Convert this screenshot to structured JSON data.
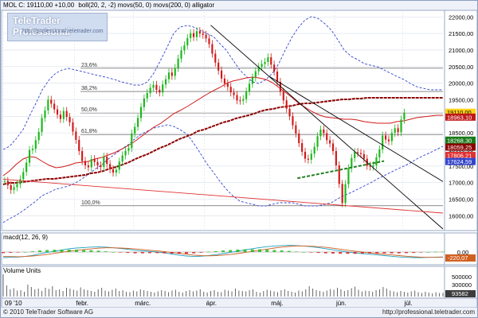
{
  "header": {
    "instrument": "MOL C: 19110,00 +10,00",
    "indicators": "boll(20, 2, -2) movs(50, 0) movs(200, 0) alligator"
  },
  "logo": {
    "title": "TeleTrader Professional",
    "url": "http://professional.teletrader.com"
  },
  "footer": {
    "copyright": "© 2010 TeleTrader Software AG",
    "url": "http://professional.teletrader.com"
  },
  "colors": {
    "bg": "#ffffff",
    "grid": "#d8dde8",
    "up": "#18b818",
    "down": "#d01818",
    "boll": "#3344cc",
    "ma50": "#d01818",
    "ma200": "#8b0000",
    "jaw": "#4060e0",
    "teeth": "#e03030",
    "lips": "#30b030",
    "trend": "#000000",
    "support": "#e03030",
    "support_dash": "#208020"
  },
  "chart_data": [
    {
      "type": "candlestick",
      "title": "MOL C: 19110,00 +10,00",
      "y_axis_side": "right",
      "ylim": [
        15600,
        22150
      ],
      "yticks": [
        16000,
        16500,
        17000,
        17500,
        18000,
        18500,
        19000,
        19500,
        20000,
        20500,
        21000,
        21500,
        22000
      ],
      "ytick_labels": [
        "16000,00",
        "16500,00",
        "17000,00",
        "17500,00",
        "18000,00",
        "18500,00",
        "19000,00",
        "19500,00",
        "20000,00",
        "20500,00",
        "21000,00",
        "21500,00",
        "22000,00"
      ],
      "xlim": [
        0,
        142
      ],
      "xticks": [
        {
          "x": 0,
          "label": "09 '10"
        },
        {
          "x": 23,
          "label": "febr."
        },
        {
          "x": 42,
          "label": "márc."
        },
        {
          "x": 65,
          "label": "ápr."
        },
        {
          "x": 86,
          "label": "máj."
        },
        {
          "x": 107,
          "label": "jún."
        },
        {
          "x": 129,
          "label": "júl."
        }
      ],
      "series": [
        {
          "name": "close",
          "values": [
            17050,
            16920,
            16780,
            16860,
            16950,
            17100,
            17320,
            17600,
            17980,
            18020,
            18280,
            18530,
            18950,
            19180,
            19500,
            19380,
            19210,
            19050,
            18920,
            19160,
            18980,
            18820,
            18540,
            18290,
            17950,
            17650,
            17520,
            17460,
            17710,
            17620,
            17520,
            17470,
            17780,
            17560,
            17400,
            17300,
            17390,
            17630,
            17820,
            17960,
            18040,
            18480,
            18680,
            18950,
            19280,
            19540,
            19700,
            19860,
            19950,
            19800,
            19720,
            19960,
            20120,
            20320,
            20220,
            20460,
            20740,
            20990,
            21140,
            21360,
            21510,
            21390,
            21570,
            21500,
            21460,
            21350,
            21180,
            20890,
            20620,
            20380,
            20140,
            19990,
            19890,
            19720,
            19640,
            19480,
            19470,
            19520,
            19750,
            19980,
            20170,
            20360,
            20490,
            20580,
            20640,
            20780,
            20560,
            20350,
            20040,
            19740,
            19480,
            19230,
            19000,
            18730,
            18480,
            18190,
            17930,
            17720,
            17690,
            17870,
            18080,
            18400,
            18600,
            18490,
            18280,
            18180,
            17950,
            17520,
            16960,
            16380,
            16950,
            17430,
            17740,
            17920,
            17890,
            17860,
            17720,
            17510,
            17480,
            17520,
            17760,
            18000,
            18420,
            18300,
            18250,
            18500,
            18640,
            18520,
            18900,
            19110
          ]
        },
        {
          "name": "open",
          "values": [
            17050,
            17050,
            16920,
            16780,
            16860,
            16950,
            17100,
            17320,
            17600,
            17980,
            18020,
            18280,
            18530,
            18950,
            19180,
            19500,
            19380,
            19210,
            19050,
            18920,
            19160,
            18980,
            18820,
            18540,
            18290,
            17950,
            17650,
            17520,
            17460,
            17710,
            17620,
            17520,
            17470,
            17780,
            17560,
            17400,
            17300,
            17390,
            17630,
            17820,
            17960,
            18040,
            18480,
            18680,
            18950,
            19280,
            19540,
            19700,
            19860,
            19950,
            19800,
            19720,
            19960,
            20120,
            20320,
            20220,
            20460,
            20740,
            20990,
            21140,
            21360,
            21510,
            21390,
            21570,
            21500,
            21460,
            21350,
            21180,
            20890,
            20620,
            20380,
            20140,
            19990,
            19890,
            19720,
            19640,
            19480,
            19470,
            19520,
            19750,
            19980,
            20170,
            20360,
            20490,
            20580,
            20640,
            20780,
            20560,
            20350,
            20040,
            19740,
            19480,
            19230,
            19000,
            18730,
            18480,
            18190,
            17930,
            17720,
            17690,
            17870,
            18080,
            18400,
            18600,
            18490,
            18280,
            18180,
            17950,
            17520,
            16960,
            16380,
            16950,
            17430,
            17740,
            17920,
            17890,
            17860,
            17720,
            17510,
            17480,
            17520,
            17760,
            18000,
            18420,
            18300,
            18250,
            18500,
            18640,
            18520,
            18900
          ]
        },
        {
          "name": "Bollinger upper",
          "values": [
            18000,
            18100,
            18300,
            18600,
            19000,
            19400,
            19800,
            20100,
            20300,
            20400,
            20450,
            20400,
            20350,
            20300,
            20250,
            20200,
            20150,
            20100,
            20050,
            20000,
            19950,
            19950,
            20050,
            20300,
            20700,
            21100,
            21500,
            21700,
            21750,
            21700,
            21600,
            21500,
            21400,
            21200,
            21000,
            20700,
            20400,
            20200,
            20050,
            20000,
            20100,
            20300,
            20600,
            21000,
            21400,
            21700,
            21900,
            22000,
            21950,
            21800,
            21600,
            21300,
            21000,
            20800,
            20700,
            20600,
            20550,
            20500,
            20400,
            20300,
            20200,
            20100,
            20000,
            19900,
            19850,
            19800,
            19800,
            19800
          ]
        },
        {
          "name": "Bollinger lower",
          "values": [
            15800,
            15900,
            16000,
            16150,
            16300,
            16450,
            16600,
            16700,
            16800,
            16850,
            16900,
            17000,
            17100,
            17250,
            17400,
            17550,
            17700,
            17850,
            18000,
            18150,
            18300,
            18450,
            18550,
            18650,
            18700,
            18750,
            18700,
            18600,
            18450,
            18200,
            17900,
            17600,
            17300,
            17050,
            16800,
            16600,
            16450,
            16400,
            16350,
            16300,
            16300,
            16350,
            16400,
            16400,
            16400,
            16350,
            16300,
            16300,
            16300,
            16350,
            16400,
            16500,
            16600,
            16700,
            16800,
            16900,
            17000,
            17100,
            17200,
            17300,
            17400,
            17500,
            17600,
            17700,
            17800,
            17900,
            18000,
            18100
          ]
        },
        {
          "name": "movs(50)",
          "values": [
            17200,
            17350,
            17550,
            17700,
            17780,
            17750,
            17650,
            17520,
            17440,
            17460,
            17520,
            17580,
            17620,
            17650,
            17700,
            17760,
            17820,
            17900,
            18000,
            18120,
            18250,
            18380,
            18520,
            18660,
            18800,
            18940,
            19070,
            19180,
            19290,
            19410,
            19530,
            19650,
            19770,
            19880,
            19980,
            20060,
            20120,
            20160,
            20180,
            20170,
            20120,
            20020,
            19880,
            19720,
            19560,
            19400,
            19260,
            19150,
            19060,
            18990,
            18950,
            18930,
            18920,
            18900,
            18880,
            18850,
            18820,
            18800,
            18790,
            18800,
            18830,
            18870,
            18910,
            18950,
            18980,
            19000,
            19020,
            19030
          ]
        },
        {
          "name": "movs(200)",
          "values": [
            16950,
            16980,
            17000,
            17020,
            17040,
            17060,
            17080,
            17100,
            17120,
            17140,
            17160,
            17180,
            17200,
            17230,
            17270,
            17310,
            17360,
            17420,
            17480,
            17550,
            17620,
            17700,
            17780,
            17860,
            17950,
            18040,
            18130,
            18220,
            18300,
            18380,
            18460,
            18540,
            18610,
            18680,
            18750,
            18810,
            18870,
            18930,
            18990,
            19040,
            19090,
            19140,
            19190,
            19230,
            19270,
            19300,
            19330,
            19360,
            19380,
            19400,
            19420,
            19440,
            19460,
            19480,
            19500,
            19520,
            19530,
            19540,
            19550,
            19550,
            19550,
            19560,
            19560,
            19560,
            19560,
            19560,
            19560,
            19560,
            19560,
            19560,
            19560
          ]
        }
      ],
      "price_labels": [
        "19110,00",
        "18963,10",
        "18268,30",
        "18059,25",
        "17806,21",
        "17624,59"
      ],
      "fibonacci": [
        {
          "label": "23,6%",
          "level": 20450
        },
        {
          "label": "38,2%",
          "level": 19750
        },
        {
          "label": "50,0%",
          "level": 19100
        },
        {
          "label": "61,8%",
          "level": 18450
        },
        {
          "label": "100,0%",
          "level": 16300
        }
      ],
      "trendlines": [
        {
          "name": "falling trendline 1",
          "from": [
            67,
            21750
          ],
          "to": [
            142,
            15600
          ]
        },
        {
          "name": "falling trendline 2",
          "from": [
            86,
            20200
          ],
          "to": [
            142,
            17030
          ]
        },
        {
          "name": "long support",
          "from": [
            0,
            17100
          ],
          "to": [
            142,
            16080
          ]
        },
        {
          "name": "short support",
          "from": [
            95,
            17130
          ],
          "to": [
            123,
            17650
          ]
        }
      ]
    },
    {
      "type": "line",
      "title": "macd(12, 26, 9)",
      "ylim": [
        -500,
        500
      ],
      "yticks": [
        0
      ],
      "ytick_labels": [
        "0,00"
      ],
      "value_label": "-220,07",
      "series": [
        {
          "name": "macd",
          "values": [
            -250,
            -240,
            -230,
            -200,
            -150,
            -80,
            -20,
            40,
            90,
            150,
            180,
            200,
            220,
            230,
            220,
            190,
            160,
            120,
            80,
            50,
            30,
            0,
            -40,
            -90,
            -140,
            -180,
            -200,
            -190,
            -160,
            -120,
            -70,
            -20,
            40,
            100,
            150,
            200,
            240,
            270,
            290,
            300,
            290,
            270,
            240,
            200,
            150,
            100,
            50,
            0,
            -40,
            -70,
            -100,
            -130,
            -160,
            -190,
            -220,
            -240,
            -250,
            -250,
            -240,
            -230,
            -220
          ]
        },
        {
          "name": "signal",
          "values": [
            -200,
            -205,
            -210,
            -200,
            -180,
            -150,
            -110,
            -60,
            -10,
            40,
            80,
            110,
            140,
            170,
            190,
            190,
            180,
            160,
            140,
            110,
            80,
            50,
            20,
            -20,
            -60,
            -100,
            -140,
            -160,
            -170,
            -160,
            -140,
            -110,
            -70,
            -20,
            30,
            80,
            130,
            180,
            220,
            250,
            270,
            270,
            260,
            240,
            210,
            170,
            130,
            80,
            40,
            0,
            -40,
            -70,
            -100,
            -130,
            -160,
            -190,
            -210,
            -230,
            -240,
            -240,
            -235
          ]
        },
        {
          "name": "histogram",
          "values": [
            -50,
            -35,
            -20,
            0,
            30,
            70,
            90,
            100,
            100,
            110,
            100,
            90,
            80,
            60,
            30,
            0,
            -20,
            -40,
            -60,
            -60,
            -50,
            -50,
            -60,
            -70,
            -80,
            -80,
            -60,
            -30,
            10,
            40,
            70,
            90,
            110,
            120,
            120,
            120,
            110,
            90,
            70,
            50,
            20,
            0,
            -20,
            -40,
            -60,
            -70,
            -80,
            -80,
            -80,
            -70,
            -60,
            -60,
            -60,
            -60,
            -60,
            -50,
            -40,
            -20,
            0,
            10,
            15
          ]
        }
      ]
    },
    {
      "type": "bar",
      "title": "Volume Units",
      "ylim": [
        0,
        560000
      ],
      "yticks": [
        300000,
        500000
      ],
      "ytick_labels": [
        "300000",
        "500000"
      ],
      "value_label": "93582",
      "values": [
        620000,
        280000,
        180000,
        210000,
        150000,
        160000,
        120000,
        300000,
        240000,
        180000,
        200000,
        140000,
        220000,
        190000,
        260000,
        160000,
        180000,
        140000,
        220000,
        200000,
        170000,
        150000,
        230000,
        180000,
        160000,
        140000,
        120000,
        180000,
        220000,
        150000,
        130000,
        170000,
        200000,
        140000,
        160000,
        120000,
        110000,
        150000,
        130000,
        180000,
        160000,
        140000,
        120000,
        100000,
        130000,
        160000,
        140000,
        110000,
        150000,
        170000,
        120000,
        100000,
        140000,
        160000,
        130000,
        150000,
        180000,
        120000,
        100000,
        140000,
        160000,
        120000,
        110000,
        170000,
        150000,
        130000,
        200000,
        150000,
        140000,
        130000,
        160000,
        180000,
        120000,
        100000,
        140000,
        170000,
        150000,
        130000,
        110000,
        160000,
        180000,
        140000,
        120000,
        100000,
        150000,
        130000,
        180000,
        260000,
        200000,
        160000,
        140000,
        120000,
        150000,
        190000,
        170000,
        220000,
        180000,
        140000,
        160000,
        210000,
        250000,
        170000,
        130000,
        150000,
        140000,
        120000,
        160000,
        180000,
        240000,
        200000,
        150000,
        130000,
        110000,
        140000,
        120000,
        100000,
        130000,
        150000,
        110000,
        90000,
        120000,
        100000,
        80000,
        110000,
        90000,
        93582
      ]
    }
  ]
}
